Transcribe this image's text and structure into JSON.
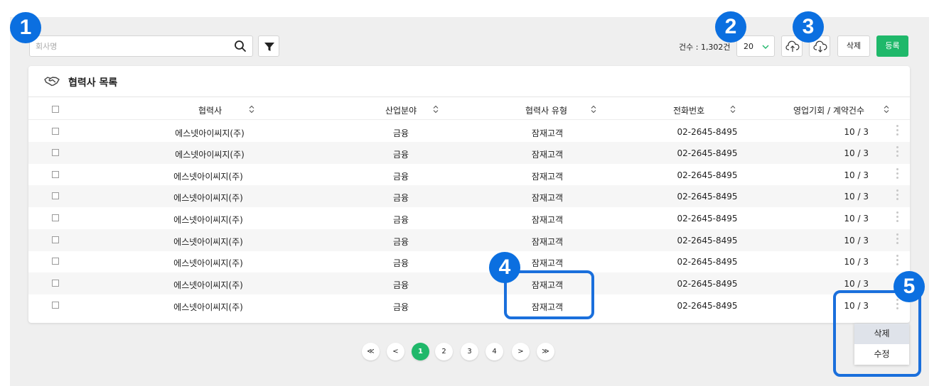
{
  "toolbar": {
    "search_placeholder": "회사명",
    "count_label": "건수 : 1,302건",
    "page_size": "20",
    "delete_label": "삭제",
    "register_label": "등록"
  },
  "card": {
    "title": "협력사 목록"
  },
  "table": {
    "headers": [
      "협력사",
      "산업분야",
      "협력사 유형",
      "전화번호",
      "영업기회 / 계약건수"
    ],
    "rows": [
      {
        "partner": "에스넷아이씨지(주)",
        "industry": "금융",
        "type": "잠재고객",
        "phone": "02-2645-8495",
        "deals": "10 / 3"
      },
      {
        "partner": "에스넷아이씨지(주)",
        "industry": "금융",
        "type": "잠재고객",
        "phone": "02-2645-8495",
        "deals": "10 / 3"
      },
      {
        "partner": "에스넷아이씨지(주)",
        "industry": "금융",
        "type": "잠재고객",
        "phone": "02-2645-8495",
        "deals": "10 / 3"
      },
      {
        "partner": "에스넷아이씨지(주)",
        "industry": "금융",
        "type": "잠재고객",
        "phone": "02-2645-8495",
        "deals": "10 / 3"
      },
      {
        "partner": "에스넷아이씨지(주)",
        "industry": "금융",
        "type": "잠재고객",
        "phone": "02-2645-8495",
        "deals": "10 / 3"
      },
      {
        "partner": "에스넷아이씨지(주)",
        "industry": "금융",
        "type": "잠재고객",
        "phone": "02-2645-8495",
        "deals": "10 / 3"
      },
      {
        "partner": "에스넷아이씨지(주)",
        "industry": "금융",
        "type": "잠재고객",
        "phone": "02-2645-8495",
        "deals": "10 / 3"
      },
      {
        "partner": "에스넷아이씨지(주)",
        "industry": "금융",
        "type": "잠재고객",
        "phone": "02-2645-8495",
        "deals": "10 / 3"
      },
      {
        "partner": "에스넷아이씨지(주)",
        "industry": "금융",
        "type": "잠재고객",
        "phone": "02-2645-8495",
        "deals": "10 / 3"
      }
    ]
  },
  "pagination": {
    "first": "≪",
    "prev": "<",
    "pages": [
      "1",
      "2",
      "3",
      "4"
    ],
    "active_page": "1",
    "next": ">",
    "last": "≫"
  },
  "row_menu": {
    "delete_label": "삭제",
    "edit_label": "수정"
  },
  "callouts": [
    "1",
    "2",
    "3",
    "4",
    "5"
  ],
  "colors": {
    "accent": "#1fb86a",
    "callout": "#0b6fe0"
  }
}
